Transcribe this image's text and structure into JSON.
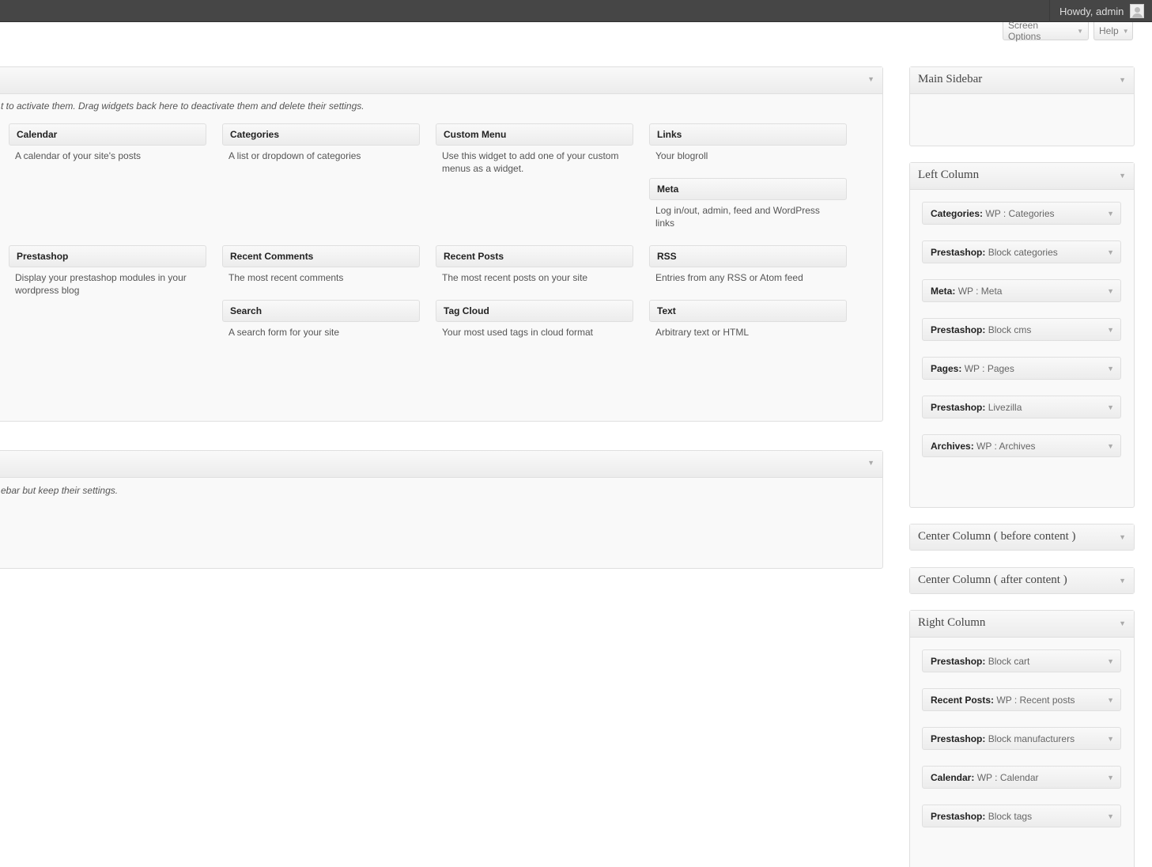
{
  "admin_bar": {
    "greeting": "Howdy, admin"
  },
  "screen_meta": {
    "screen_options": "Screen Options",
    "help": "Help"
  },
  "toggle_glyph": "▼",
  "available_widgets": {
    "description": "t to activate them. Drag widgets back here to deactivate them and delete their settings.",
    "widgets": [
      {
        "title": "Calendar",
        "desc": "A calendar of your site's posts"
      },
      {
        "title": "Categories",
        "desc": "A list or dropdown of categories"
      },
      {
        "title": "Custom Menu",
        "desc": "Use this widget to add one of your custom menus as a widget."
      },
      {
        "title": "Links",
        "desc": "Your blogroll"
      },
      {
        "title": "Meta",
        "desc": "Log in/out, admin, feed and WordPress links"
      },
      {
        "title": "Prestashop",
        "desc": "Display your prestashop modules in your wordpress blog"
      },
      {
        "title": "Recent Comments",
        "desc": "The most recent comments"
      },
      {
        "title": "Recent Posts",
        "desc": "The most recent posts on your site"
      },
      {
        "title": "RSS",
        "desc": "Entries from any RSS or Atom feed"
      },
      {
        "title": "Search",
        "desc": "A search form for your site"
      },
      {
        "title": "Tag Cloud",
        "desc": "Your most used tags in cloud format"
      },
      {
        "title": "Text",
        "desc": "Arbitrary text or HTML"
      }
    ]
  },
  "inactive_widgets": {
    "description": "ebar but keep their settings."
  },
  "sidebars": [
    {
      "title": "Main Sidebar",
      "widgets": []
    },
    {
      "title": "Left Column",
      "widgets": [
        {
          "name": "Categories:",
          "instance": "WP : Categories"
        },
        {
          "name": "Prestashop:",
          "instance": "Block categories"
        },
        {
          "name": "Meta:",
          "instance": "WP : Meta"
        },
        {
          "name": "Prestashop:",
          "instance": "Block cms"
        },
        {
          "name": "Pages:",
          "instance": "WP : Pages"
        },
        {
          "name": "Prestashop:",
          "instance": "Livezilla"
        },
        {
          "name": "Archives:",
          "instance": "WP : Archives"
        }
      ]
    },
    {
      "title": "Center Column ( before content )",
      "widgets": []
    },
    {
      "title": "Center Column ( after content )",
      "widgets": []
    },
    {
      "title": "Right Column",
      "widgets": [
        {
          "name": "Prestashop:",
          "instance": "Block cart"
        },
        {
          "name": "Recent Posts:",
          "instance": "WP : Recent posts"
        },
        {
          "name": "Prestashop:",
          "instance": "Block manufacturers"
        },
        {
          "name": "Calendar:",
          "instance": "WP : Calendar"
        },
        {
          "name": "Prestashop:",
          "instance": "Block tags"
        }
      ]
    }
  ]
}
